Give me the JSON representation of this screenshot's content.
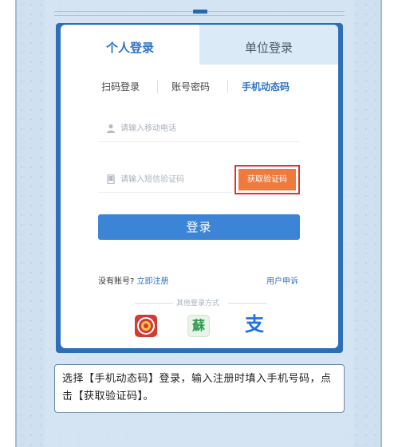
{
  "login_tabs": {
    "personal": "个人登录",
    "unit": "单位登录"
  },
  "sub_tabs": {
    "qr": "扫码登录",
    "password": "账号密码",
    "sms": "手机动态码"
  },
  "phone_field": {
    "placeholder": "请输入移动电话",
    "icon": "user-icon"
  },
  "code_field": {
    "placeholder": "请输入短信验证码",
    "icon": "phone-icon"
  },
  "get_code_button": "获取验证码",
  "login_button": "登录",
  "no_account": {
    "text": "没有账号?",
    "link": "立即注册"
  },
  "appeal_link": "用户申诉",
  "other_methods_label": "其他登录方式",
  "alt_logins": [
    {
      "icon": "emblem-app-icon"
    },
    {
      "icon": "su-app-icon",
      "glyph": "蘇"
    },
    {
      "icon": "alipay-icon",
      "glyph": "支"
    }
  ],
  "instruction": "选择【手机动态码】登录，输入注册时填入手机号码，点击【获取验证码】。",
  "colors": {
    "accent": "#2f74c4",
    "button": "#3c85d6",
    "highlight_border": "#e6312c",
    "sms_button": "#ef7a3b"
  }
}
